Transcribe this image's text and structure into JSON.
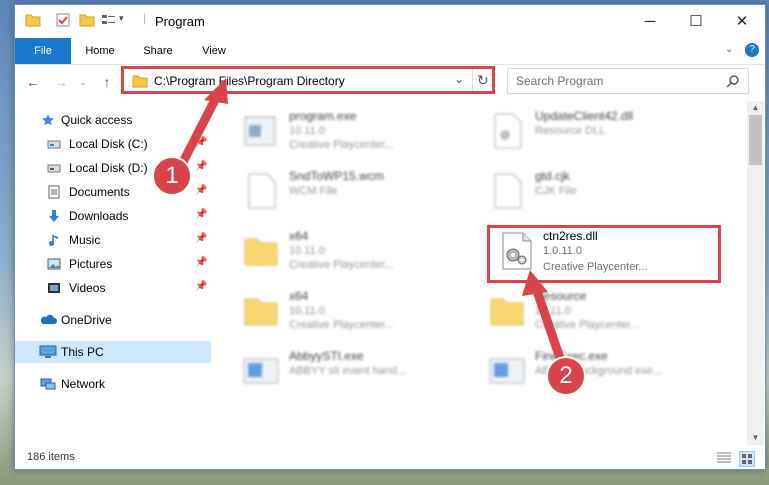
{
  "window": {
    "title": "Program"
  },
  "ribbon": {
    "tabs": [
      "File",
      "Home",
      "Share",
      "View"
    ]
  },
  "address": {
    "path": "C:\\Program Files\\Program Directory"
  },
  "search": {
    "placeholder": "Search Program"
  },
  "nav": {
    "items": [
      {
        "label": "Quick access",
        "icon": "star-icon"
      },
      {
        "label": "Local Disk (C:)",
        "icon": "drive-icon"
      },
      {
        "label": "Local Disk (D:)",
        "icon": "drive-icon"
      },
      {
        "label": "Documents",
        "icon": "documents-icon"
      },
      {
        "label": "Downloads",
        "icon": "download-icon"
      },
      {
        "label": "Music",
        "icon": "music-icon"
      },
      {
        "label": "Pictures",
        "icon": "pictures-icon"
      },
      {
        "label": "Videos",
        "icon": "videos-icon"
      },
      {
        "label": "OneDrive",
        "icon": "cloud-icon"
      },
      {
        "label": "This PC",
        "icon": "computer-icon"
      },
      {
        "label": "Network",
        "icon": "network-icon"
      }
    ]
  },
  "files": [
    {
      "name": "program.exe",
      "l1": "10.11.0",
      "l2": "Creative Playcenter..."
    },
    {
      "name": "UpdateClient42.dll",
      "l1": "Resource DLL",
      "l2": ""
    },
    {
      "name": "SndToWP15.wcm",
      "l1": "WCM File",
      "l2": ""
    },
    {
      "name": "gtd.cjk",
      "l1": "CJK File",
      "l2": ""
    },
    {
      "name": "x64",
      "l1": "10.11.0",
      "l2": "Creative Playcenter..."
    },
    {
      "name": "ctn2res.dll",
      "l1": "1.0.11.0",
      "l2": "Creative Playcenter..."
    },
    {
      "name": "x64",
      "l1": "10.11.0",
      "l2": "Creative Playcenter..."
    },
    {
      "name": "Resource",
      "l1": "10.11.0",
      "l2": "Creative Playcenter..."
    },
    {
      "name": "AbbyySTI.exe",
      "l1": "ABBYY sti event hand...",
      "l2": ""
    },
    {
      "name": "FineExec.exe",
      "l1": "ABBYY background exe...",
      "l2": ""
    }
  ],
  "status": {
    "count": "186 items"
  },
  "callouts": {
    "one": "1",
    "two": "2"
  },
  "colors": {
    "accent": "#1979ca",
    "highlight": "#d9434a",
    "selected": "#cce8ff"
  }
}
